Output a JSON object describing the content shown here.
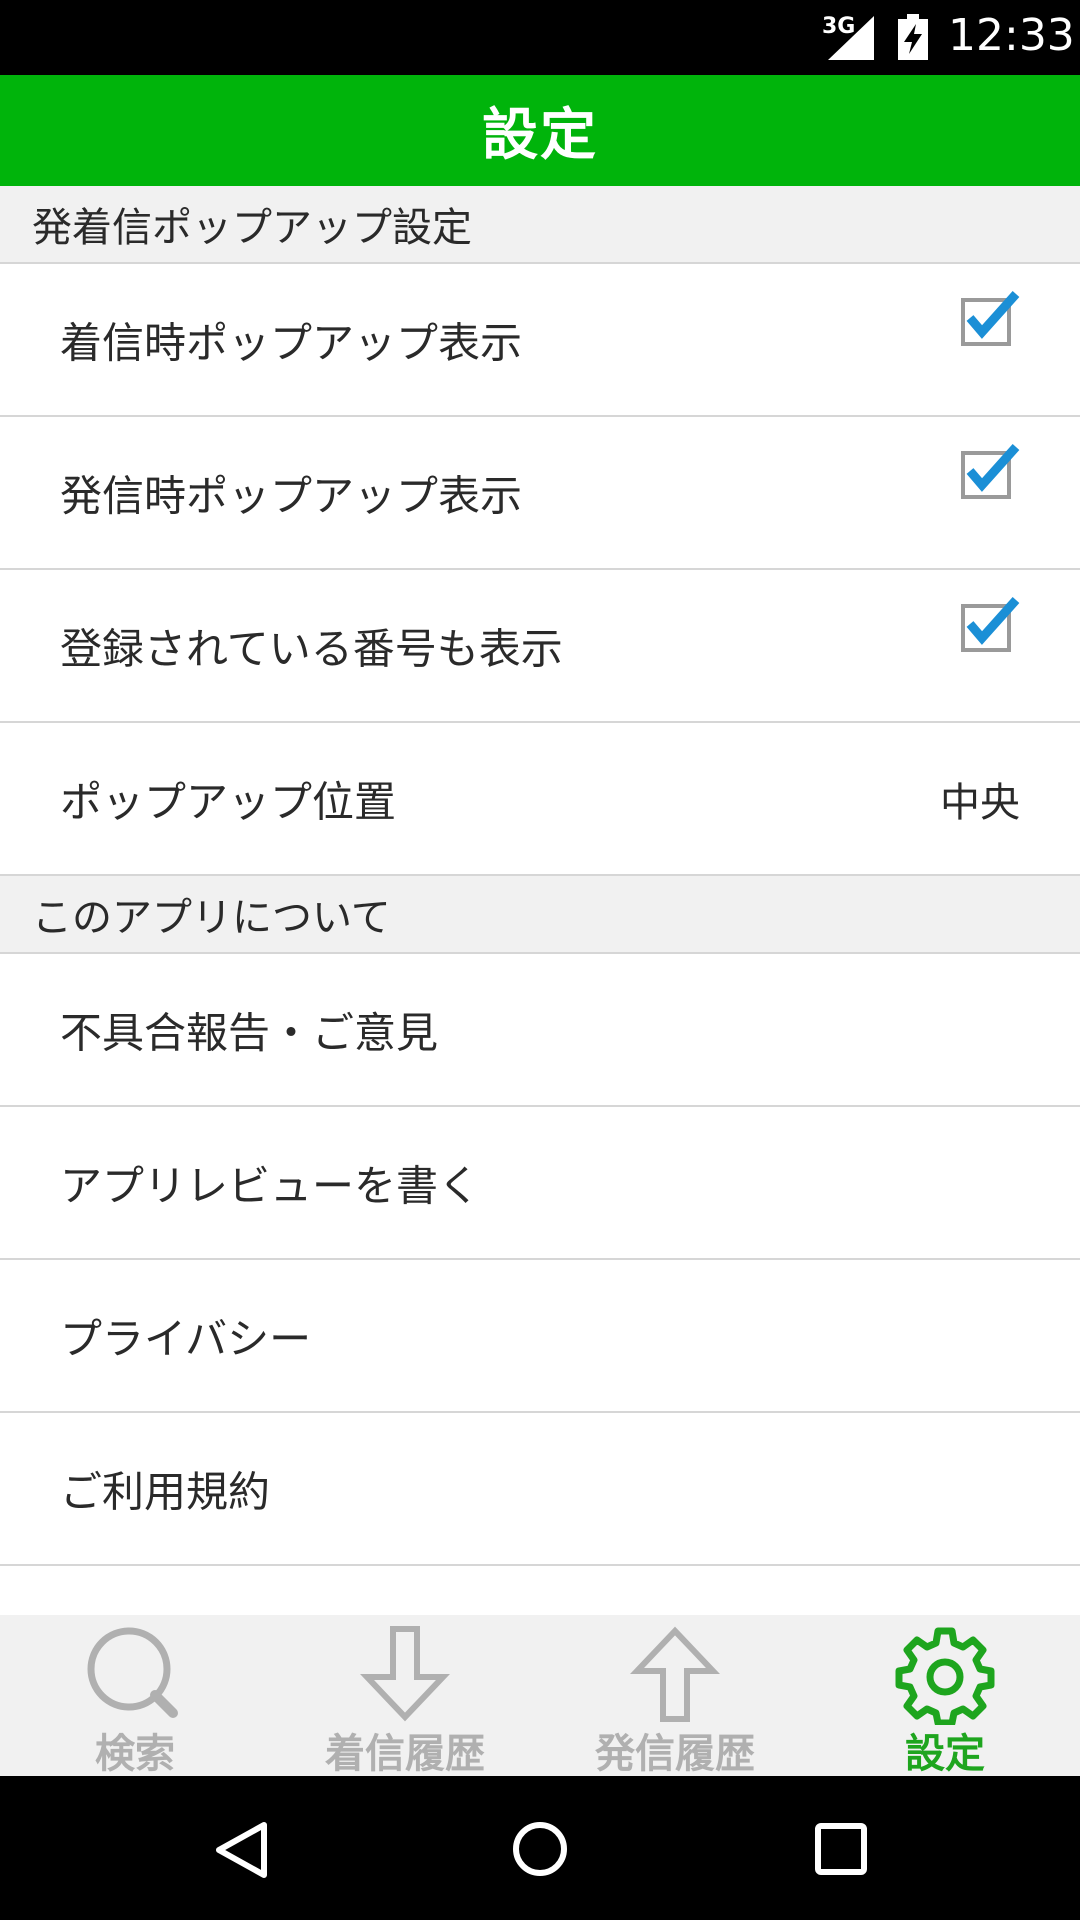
{
  "status_bar": {
    "network": "3G",
    "time": "12:33"
  },
  "app_bar": {
    "title": "設定"
  },
  "sections": [
    {
      "header": "発着信ポップアップ設定",
      "items": [
        {
          "label": "着信時ポップアップ表示",
          "checked": true
        },
        {
          "label": "発信時ポップアップ表示",
          "checked": true
        },
        {
          "label": "登録されている番号も表示",
          "checked": true
        },
        {
          "label": "ポップアップ位置",
          "value": "中央"
        }
      ]
    },
    {
      "header": "このアプリについて",
      "items": [
        {
          "label": "不具合報告・ご意見"
        },
        {
          "label": "アプリレビューを書く"
        },
        {
          "label": "プライバシー"
        },
        {
          "label": "ご利用規約"
        }
      ]
    }
  ],
  "bottom_nav": {
    "items": [
      {
        "label": "検索",
        "icon": "search-icon",
        "active": false
      },
      {
        "label": "着信履歴",
        "icon": "arrow-down-icon",
        "active": false
      },
      {
        "label": "発信履歴",
        "icon": "arrow-up-icon",
        "active": false
      },
      {
        "label": "設定",
        "icon": "gear-icon",
        "active": true
      }
    ]
  },
  "colors": {
    "accent": "#00b40b",
    "checkbox_check": "#1b8fd6",
    "nav_active": "#1ea51e",
    "nav_inactive": "#b0b0b0"
  }
}
